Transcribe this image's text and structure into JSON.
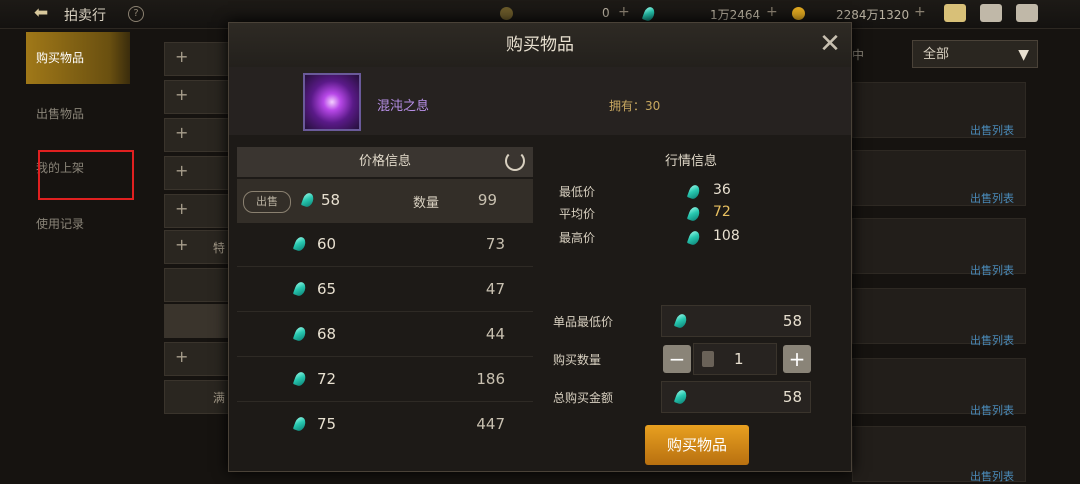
{
  "topbar": {
    "title": "拍卖行",
    "help": "?",
    "currency_1": "0",
    "currency_2": "1万2464",
    "currency_3": "2284万1320",
    "plus": "+"
  },
  "sidebar": {
    "items": [
      {
        "label": "购买物品"
      },
      {
        "label": "出售物品"
      },
      {
        "label": "我的上架"
      },
      {
        "label": "使用记录"
      }
    ]
  },
  "background": {
    "filter": "全部",
    "filter_tab": "中",
    "row_link": "出售列表",
    "row_partial_1": "特",
    "row_partial_2": "满"
  },
  "modal": {
    "title": "购买物品",
    "close": "✕",
    "item": {
      "name": "混沌之息",
      "owned": "拥有：30"
    },
    "price_panel": {
      "header": "价格信息",
      "sell_badge": "出售",
      "qty_label": "数量",
      "rows": [
        {
          "price": "58",
          "qty": "99"
        },
        {
          "price": "60",
          "qty": "73"
        },
        {
          "price": "65",
          "qty": "47"
        },
        {
          "price": "68",
          "qty": "44"
        },
        {
          "price": "72",
          "qty": "186"
        },
        {
          "price": "75",
          "qty": "447"
        }
      ]
    },
    "market_panel": {
      "header": "行情信息",
      "rows": [
        {
          "label": "最低价",
          "value": "36"
        },
        {
          "label": "平均价",
          "value": "72"
        },
        {
          "label": "最高价",
          "value": "108"
        }
      ]
    },
    "form": {
      "unit_price_label": "单品最低价",
      "unit_price": "58",
      "qty_label": "购买数量",
      "qty": "1",
      "minus": "−",
      "plus": "+",
      "total_label": "总购买金额",
      "total": "58"
    },
    "buy_button": "购买物品"
  },
  "colors": {
    "accent_gold": "#e8a020",
    "gem": "#28c8b0",
    "highlight": "#e02020"
  }
}
